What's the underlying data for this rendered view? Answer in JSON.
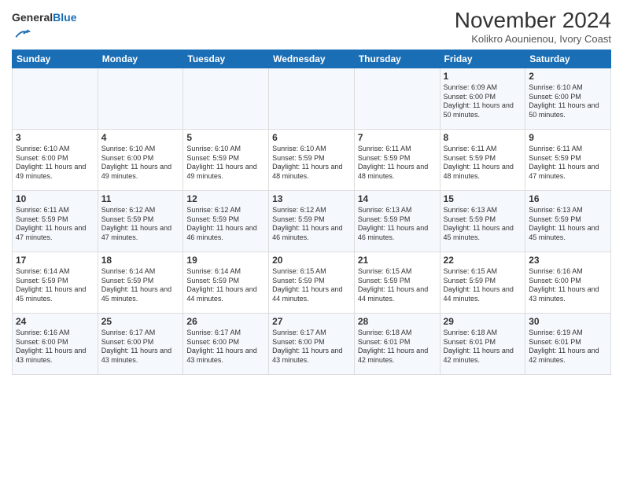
{
  "header": {
    "logo_general": "General",
    "logo_blue": "Blue",
    "month_title": "November 2024",
    "location": "Kolikro Aounienou, Ivory Coast"
  },
  "days_of_week": [
    "Sunday",
    "Monday",
    "Tuesday",
    "Wednesday",
    "Thursday",
    "Friday",
    "Saturday"
  ],
  "weeks": [
    [
      {
        "day": "",
        "content": ""
      },
      {
        "day": "",
        "content": ""
      },
      {
        "day": "",
        "content": ""
      },
      {
        "day": "",
        "content": ""
      },
      {
        "day": "",
        "content": ""
      },
      {
        "day": "1",
        "content": "Sunrise: 6:09 AM\nSunset: 6:00 PM\nDaylight: 11 hours and 50 minutes."
      },
      {
        "day": "2",
        "content": "Sunrise: 6:10 AM\nSunset: 6:00 PM\nDaylight: 11 hours and 50 minutes."
      }
    ],
    [
      {
        "day": "3",
        "content": "Sunrise: 6:10 AM\nSunset: 6:00 PM\nDaylight: 11 hours and 49 minutes."
      },
      {
        "day": "4",
        "content": "Sunrise: 6:10 AM\nSunset: 6:00 PM\nDaylight: 11 hours and 49 minutes."
      },
      {
        "day": "5",
        "content": "Sunrise: 6:10 AM\nSunset: 5:59 PM\nDaylight: 11 hours and 49 minutes."
      },
      {
        "day": "6",
        "content": "Sunrise: 6:10 AM\nSunset: 5:59 PM\nDaylight: 11 hours and 48 minutes."
      },
      {
        "day": "7",
        "content": "Sunrise: 6:11 AM\nSunset: 5:59 PM\nDaylight: 11 hours and 48 minutes."
      },
      {
        "day": "8",
        "content": "Sunrise: 6:11 AM\nSunset: 5:59 PM\nDaylight: 11 hours and 48 minutes."
      },
      {
        "day": "9",
        "content": "Sunrise: 6:11 AM\nSunset: 5:59 PM\nDaylight: 11 hours and 47 minutes."
      }
    ],
    [
      {
        "day": "10",
        "content": "Sunrise: 6:11 AM\nSunset: 5:59 PM\nDaylight: 11 hours and 47 minutes."
      },
      {
        "day": "11",
        "content": "Sunrise: 6:12 AM\nSunset: 5:59 PM\nDaylight: 11 hours and 47 minutes."
      },
      {
        "day": "12",
        "content": "Sunrise: 6:12 AM\nSunset: 5:59 PM\nDaylight: 11 hours and 46 minutes."
      },
      {
        "day": "13",
        "content": "Sunrise: 6:12 AM\nSunset: 5:59 PM\nDaylight: 11 hours and 46 minutes."
      },
      {
        "day": "14",
        "content": "Sunrise: 6:13 AM\nSunset: 5:59 PM\nDaylight: 11 hours and 46 minutes."
      },
      {
        "day": "15",
        "content": "Sunrise: 6:13 AM\nSunset: 5:59 PM\nDaylight: 11 hours and 45 minutes."
      },
      {
        "day": "16",
        "content": "Sunrise: 6:13 AM\nSunset: 5:59 PM\nDaylight: 11 hours and 45 minutes."
      }
    ],
    [
      {
        "day": "17",
        "content": "Sunrise: 6:14 AM\nSunset: 5:59 PM\nDaylight: 11 hours and 45 minutes."
      },
      {
        "day": "18",
        "content": "Sunrise: 6:14 AM\nSunset: 5:59 PM\nDaylight: 11 hours and 45 minutes."
      },
      {
        "day": "19",
        "content": "Sunrise: 6:14 AM\nSunset: 5:59 PM\nDaylight: 11 hours and 44 minutes."
      },
      {
        "day": "20",
        "content": "Sunrise: 6:15 AM\nSunset: 5:59 PM\nDaylight: 11 hours and 44 minutes."
      },
      {
        "day": "21",
        "content": "Sunrise: 6:15 AM\nSunset: 5:59 PM\nDaylight: 11 hours and 44 minutes."
      },
      {
        "day": "22",
        "content": "Sunrise: 6:15 AM\nSunset: 5:59 PM\nDaylight: 11 hours and 44 minutes."
      },
      {
        "day": "23",
        "content": "Sunrise: 6:16 AM\nSunset: 6:00 PM\nDaylight: 11 hours and 43 minutes."
      }
    ],
    [
      {
        "day": "24",
        "content": "Sunrise: 6:16 AM\nSunset: 6:00 PM\nDaylight: 11 hours and 43 minutes."
      },
      {
        "day": "25",
        "content": "Sunrise: 6:17 AM\nSunset: 6:00 PM\nDaylight: 11 hours and 43 minutes."
      },
      {
        "day": "26",
        "content": "Sunrise: 6:17 AM\nSunset: 6:00 PM\nDaylight: 11 hours and 43 minutes."
      },
      {
        "day": "27",
        "content": "Sunrise: 6:17 AM\nSunset: 6:00 PM\nDaylight: 11 hours and 43 minutes."
      },
      {
        "day": "28",
        "content": "Sunrise: 6:18 AM\nSunset: 6:01 PM\nDaylight: 11 hours and 42 minutes."
      },
      {
        "day": "29",
        "content": "Sunrise: 6:18 AM\nSunset: 6:01 PM\nDaylight: 11 hours and 42 minutes."
      },
      {
        "day": "30",
        "content": "Sunrise: 6:19 AM\nSunset: 6:01 PM\nDaylight: 11 hours and 42 minutes."
      }
    ]
  ]
}
